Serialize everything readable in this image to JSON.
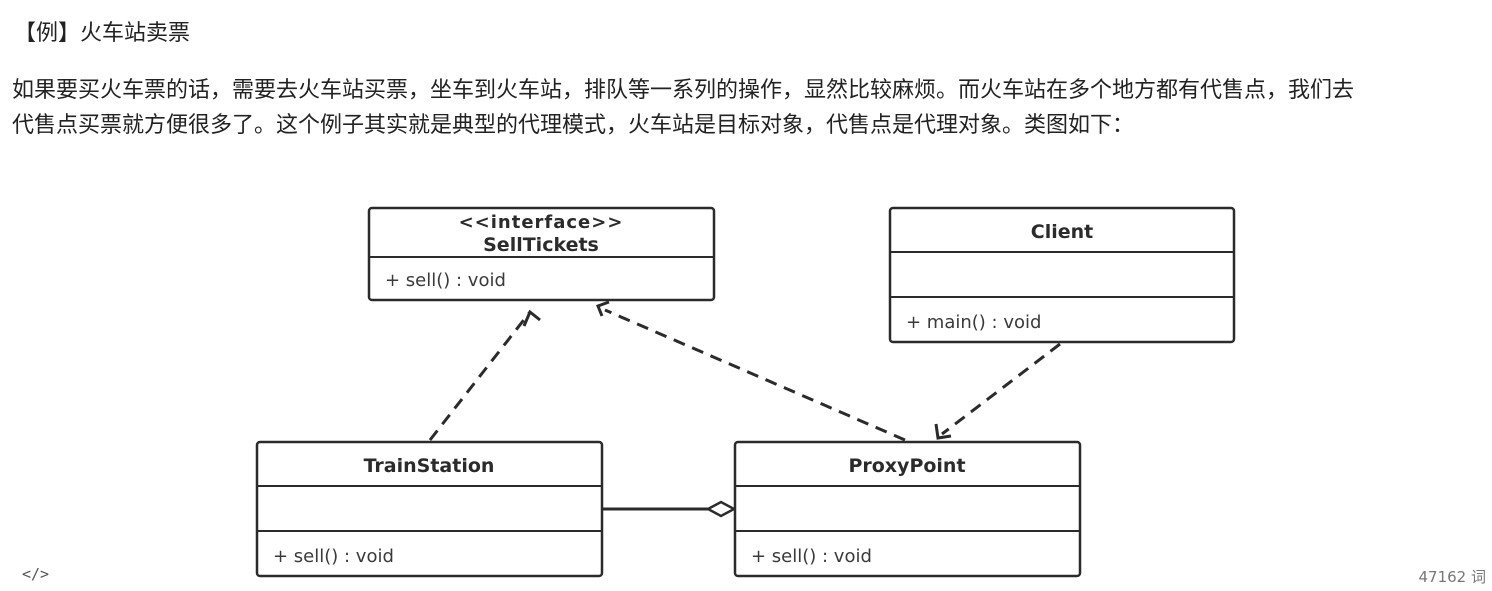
{
  "heading": "【例】火车站卖票",
  "paragraph": {
    "line1": "如果要买火车票的话，需要去火车站买票，坐车到火车站，排队等一系列的操作，显然比较麻烦。而火车站在多个地方都有代售点，我们去",
    "line2": "代售点买票就方便很多了。这个例子其实就是典型的代理模式，火车站是目标对象，代售点是代理对象。类图如下："
  },
  "diagram": {
    "classes": {
      "sellTickets": {
        "stereotype": "<<interface>>",
        "name": "SellTickets",
        "operation": "+ sell() : void"
      },
      "client": {
        "name": "Client",
        "operation": "+ main() : void"
      },
      "trainStation": {
        "name": "TrainStation",
        "operation": "+ sell() : void"
      },
      "proxyPoint": {
        "name": "ProxyPoint",
        "operation": "+ sell() : void"
      }
    },
    "relations": [
      {
        "from": "TrainStation",
        "to": "SellTickets",
        "type": "realization"
      },
      {
        "from": "ProxyPoint",
        "to": "SellTickets",
        "type": "realization"
      },
      {
        "from": "Client",
        "to": "ProxyPoint",
        "type": "dependency"
      },
      {
        "from": "TrainStation",
        "to": "ProxyPoint",
        "type": "aggregation"
      }
    ]
  },
  "footer": {
    "code_icon": "</>",
    "word_count": "47162 词"
  }
}
